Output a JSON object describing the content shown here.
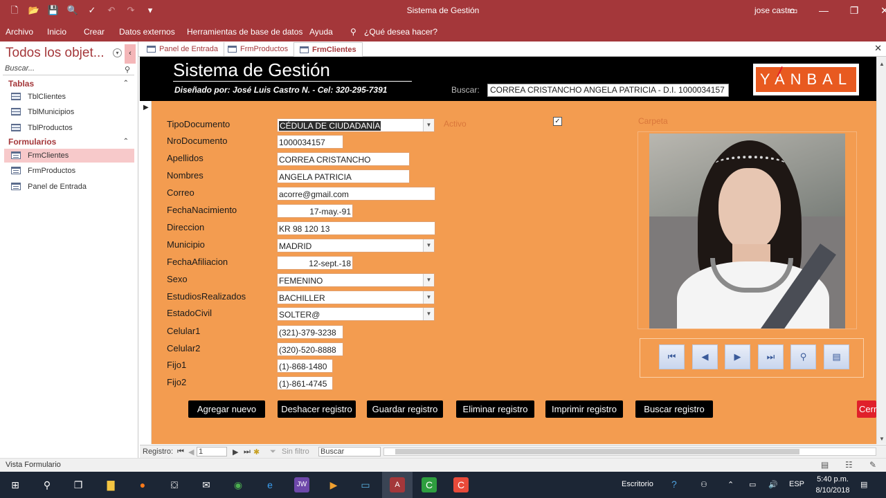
{
  "window": {
    "title": "Sistema de Gestión",
    "user": "jose castro",
    "accent": "#a4373a"
  },
  "ribbon": {
    "tabs": [
      "Archivo",
      "Inicio",
      "Crear",
      "Datos externos",
      "Herramientas de base de datos",
      "Ayuda"
    ],
    "tell_me": "¿Qué desea hacer?"
  },
  "nav_pane": {
    "title": "Todos los objet...",
    "search_placeholder": "Buscar...",
    "groups": [
      {
        "name": "Tablas",
        "items": [
          "TblClientes",
          "TblMunicipios",
          "TblProductos"
        ]
      },
      {
        "name": "Formularios",
        "items": [
          "FrmClientes",
          "FrmProductos",
          "Panel de Entrada"
        ]
      }
    ],
    "selected": "FrmClientes"
  },
  "doc_tabs": [
    "Panel de Entrada",
    "FrmProductos",
    "FrmClientes"
  ],
  "form": {
    "header_title": "Sistema de Gestión",
    "header_subtitle": "Diseñado por: José Luis Castro N. - Cel: 320-295-7391",
    "search_label": "Buscar:",
    "search_value": "CORREA CRISTANCHO ANGELA PATRICIA - D.I. 1000034157",
    "logo_text": "YANBAL",
    "fields": [
      {
        "label": "TipoDocumento",
        "value": "CÉDULA DE CIUDADANÍA"
      },
      {
        "label": "NroDocumento",
        "value": "1000034157"
      },
      {
        "label": "Apellidos",
        "value": "CORREA CRISTANCHO"
      },
      {
        "label": "Nombres",
        "value": "ANGELA PATRICIA"
      },
      {
        "label": "Correo",
        "value": "acorre@gmail.com"
      },
      {
        "label": "FechaNacimiento",
        "value": "17-may.-91"
      },
      {
        "label": "Direccion",
        "value": "KR 98 120 13"
      },
      {
        "label": "Municipio",
        "value": "MADRID"
      },
      {
        "label": "FechaAfiliacion",
        "value": "12-sept.-18"
      },
      {
        "label": "Sexo",
        "value": "FEMENINO"
      },
      {
        "label": "EstudiosRealizados",
        "value": "BACHILLER"
      },
      {
        "label": "EstadoCivil",
        "value": "SOLTER@"
      },
      {
        "label": "Celular1",
        "value": "(321)-379-3238"
      },
      {
        "label": "Celular2",
        "value": "(320)-520-8888"
      },
      {
        "label": "Fijo1",
        "value": "(1)-868-1480"
      },
      {
        "label": "Fijo2",
        "value": "(1)-861-4745"
      }
    ],
    "activo_label": "Activo",
    "activo_checked": "✓",
    "carpeta_label": "Carpeta",
    "buttons": [
      "Agregar nuevo",
      "Deshacer registro",
      "Guardar registro",
      "Eliminar registro",
      "Imprimir registro",
      "Buscar registro",
      "Cerr"
    ]
  },
  "record_bar": {
    "label": "Registro:",
    "current": "1",
    "filter": "Sin filtro",
    "search": "Buscar"
  },
  "status": {
    "text": "Vista Formulario"
  },
  "taskbar": {
    "desktop": "Escritorio",
    "lang": "ESP",
    "time": "5:40 p.m.",
    "date": "8/10/2018"
  }
}
